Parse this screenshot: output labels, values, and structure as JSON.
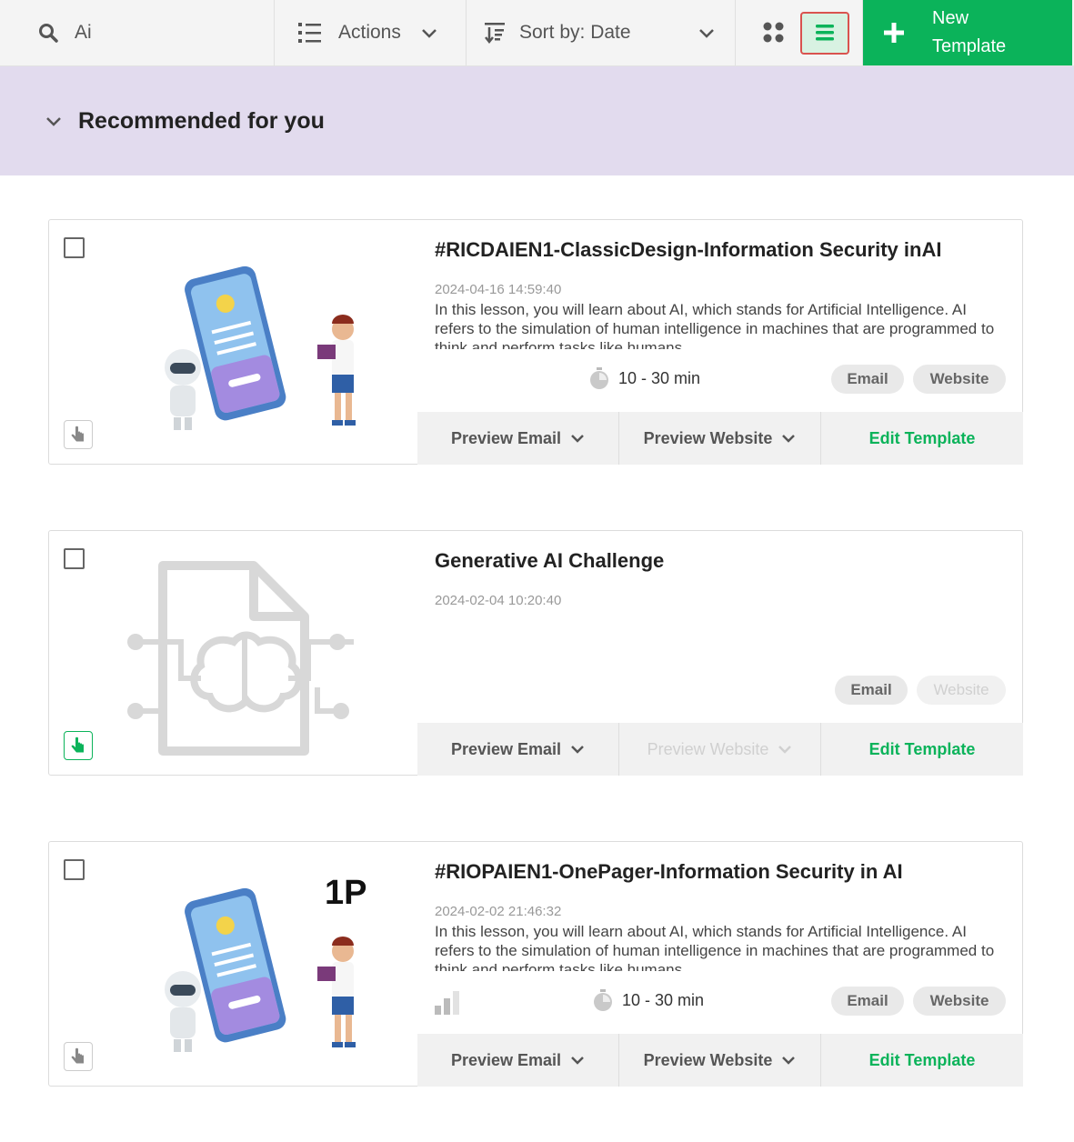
{
  "toolbar": {
    "search_value": "Ai",
    "actions_label": "Actions",
    "sort_label": "Sort by: Date",
    "new_template_label": "New\nTemplate"
  },
  "section": {
    "title": "Recommended for you"
  },
  "colors": {
    "accent": "#0bb35a",
    "section_bg": "#e2dbee",
    "highlight_border": "#d9534f"
  },
  "cards": [
    {
      "title": "#RICDAIEN1-ClassicDesign-Information Security inAI",
      "date": "2024-04-16 14:59:40",
      "description": "In this lesson, you will learn about AI, which stands for Artificial Intelligence. AI refers to the simulation of human intelligence in machines that are programmed to think and perform tasks like humans.",
      "duration": "10 - 30 min",
      "tags": [
        "Email",
        "Website"
      ],
      "buttons": [
        "Preview Email",
        "Preview Website",
        "Edit Template"
      ]
    },
    {
      "title": "Generative AI Challenge",
      "date": "2024-02-04 10:20:40",
      "tags": [
        "Email",
        "Website"
      ],
      "buttons": [
        "Preview Email",
        "Preview Website",
        "Edit Template"
      ]
    },
    {
      "title": "#RIOPAIEN1-OnePager-Information Security in AI",
      "date": "2024-02-02 21:46:32",
      "description": "In this lesson, you will learn about AI, which stands for Artificial Intelligence. AI refers to the simulation of human intelligence in machines that are programmed to think and perform tasks like humans.",
      "duration": "10 - 30 min",
      "badge_text": "1P",
      "tags": [
        "Email",
        "Website"
      ],
      "buttons": [
        "Preview Email",
        "Preview Website",
        "Edit Template"
      ]
    }
  ]
}
